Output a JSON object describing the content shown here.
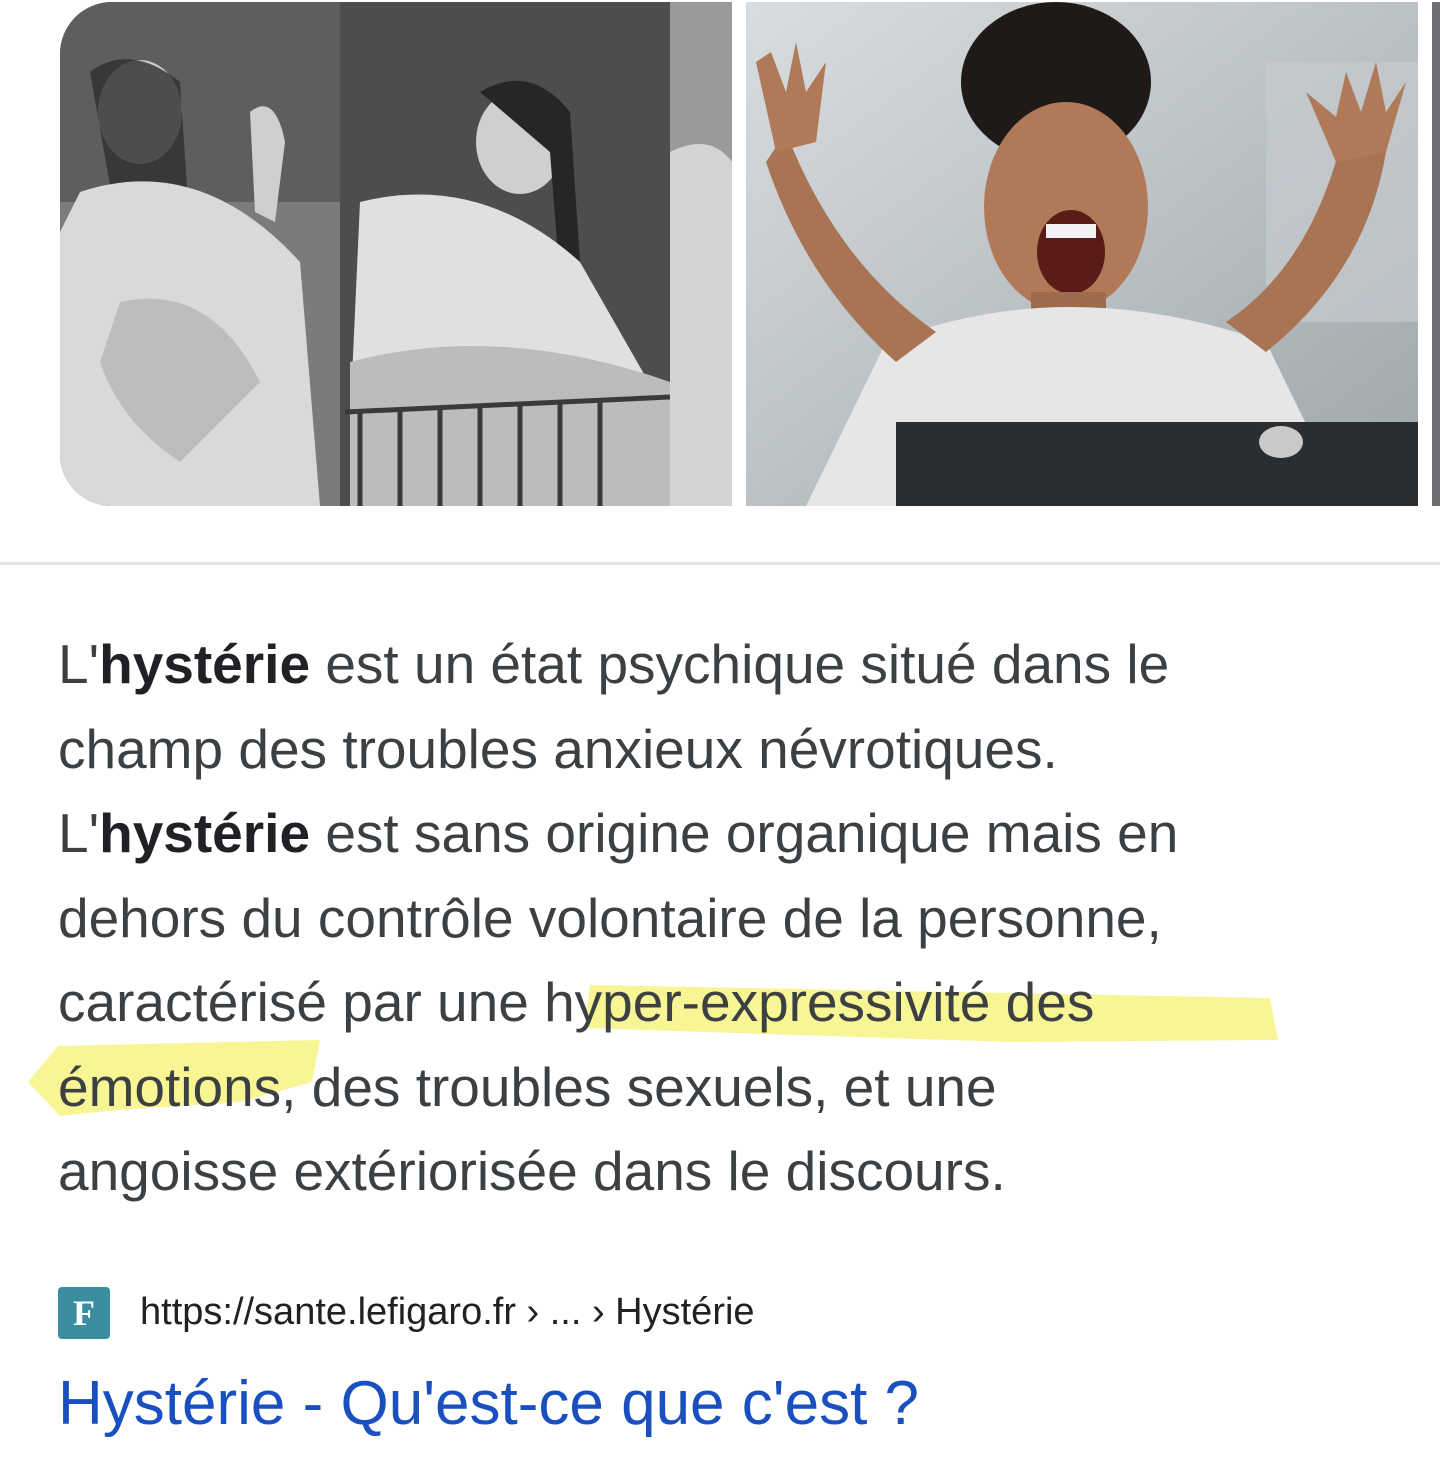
{
  "images": [
    {
      "name": "vintage-hysteria-photographs"
    },
    {
      "name": "screaming-woman-photo"
    },
    {
      "name": "next-image-partial"
    }
  ],
  "snippet": {
    "lines": [
      {
        "pre": "L'",
        "bold": "hystérie",
        "post": " est un état psychique situé dans le"
      },
      {
        "text": "champ des troubles anxieux névrotiques."
      },
      {
        "pre": "L'",
        "bold": "hystérie",
        "post": " est sans origine organique mais en"
      },
      {
        "text": "dehors du contrôle volontaire de la personne,"
      },
      {
        "text": "caractérisé par une hyper-expressivité des"
      },
      {
        "text": "émotions, des troubles sexuels, et une"
      },
      {
        "text": "angoisse extériorisée dans le discours."
      }
    ],
    "highlight_color": "#f2ee3c"
  },
  "source": {
    "favicon_letter": "F",
    "favicon_color": "#3a8ea0",
    "url": "https://sante.lefigaro.fr › ... › Hystérie"
  },
  "result": {
    "title": "Hystérie - Qu'est-ce que c'est ?",
    "link_color": "#1a4fbf"
  }
}
